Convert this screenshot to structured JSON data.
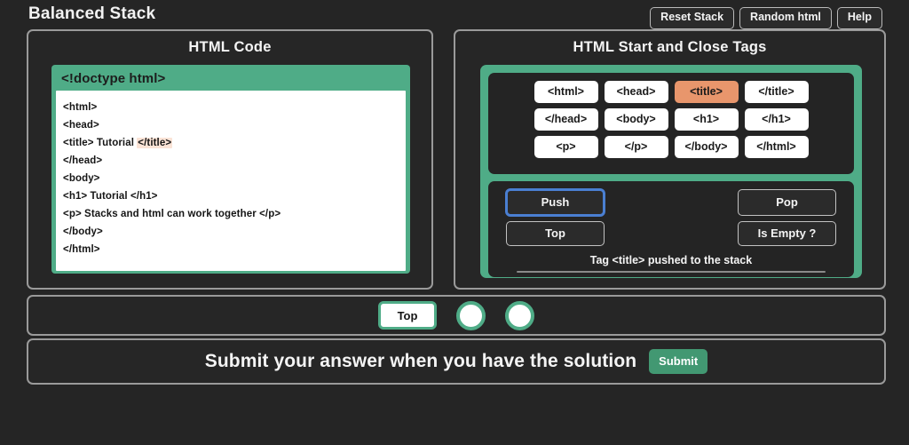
{
  "app": {
    "title": "Balanced Stack",
    "accent_green": "#4fac87",
    "selected_tag_color": "#e8966c",
    "background": "#252525"
  },
  "toolbar": {
    "buttons": [
      {
        "label": "Reset Stack",
        "name": "reset-stack-button"
      },
      {
        "label": "Random html",
        "name": "random-html-button"
      },
      {
        "label": "Help",
        "name": "help-button"
      }
    ]
  },
  "code_panel": {
    "title": "HTML Code",
    "doctype": "<!doctype html>",
    "lines": [
      {
        "text": "<html>",
        "highlight": ""
      },
      {
        "text": "<head>",
        "highlight": ""
      },
      {
        "text": "<title> Tutorial ",
        "highlight": "</title>"
      },
      {
        "text": "</head>",
        "highlight": ""
      },
      {
        "text": "<body>",
        "highlight": ""
      },
      {
        "text": "<h1> Tutorial </h1>",
        "highlight": ""
      },
      {
        "text": "<p> Stacks and html can work together </p>",
        "highlight": ""
      },
      {
        "text": "</body>",
        "highlight": ""
      },
      {
        "text": "</html>",
        "highlight": ""
      }
    ]
  },
  "tags_panel": {
    "title": "HTML Start and Close Tags",
    "rows": [
      [
        {
          "label": "<html>",
          "selected": false
        },
        {
          "label": "<head>",
          "selected": false
        },
        {
          "label": "<title>",
          "selected": true
        },
        {
          "label": "</title>",
          "selected": false
        }
      ],
      [
        {
          "label": "</head>",
          "selected": false
        },
        {
          "label": "<body>",
          "selected": false
        },
        {
          "label": "<h1>",
          "selected": false
        },
        {
          "label": "</h1>",
          "selected": false
        }
      ],
      [
        {
          "label": "<p>",
          "selected": false
        },
        {
          "label": "</p>",
          "selected": false
        },
        {
          "label": "</body>",
          "selected": false
        },
        {
          "label": "</html>",
          "selected": false
        }
      ]
    ],
    "operations": {
      "push": "Push",
      "pop": "Pop",
      "top": "Top",
      "is_empty": "Is Empty ?"
    },
    "status_message": "Tag <title> pushed to the stack"
  },
  "stack_strip": {
    "top_label": "Top",
    "slots": [
      {
        "name": "stack-slot-1",
        "filled": false
      },
      {
        "name": "stack-slot-2",
        "filled": false
      }
    ]
  },
  "submit_bar": {
    "prompt": "Submit your answer when you have the solution",
    "button_label": "Submit"
  }
}
